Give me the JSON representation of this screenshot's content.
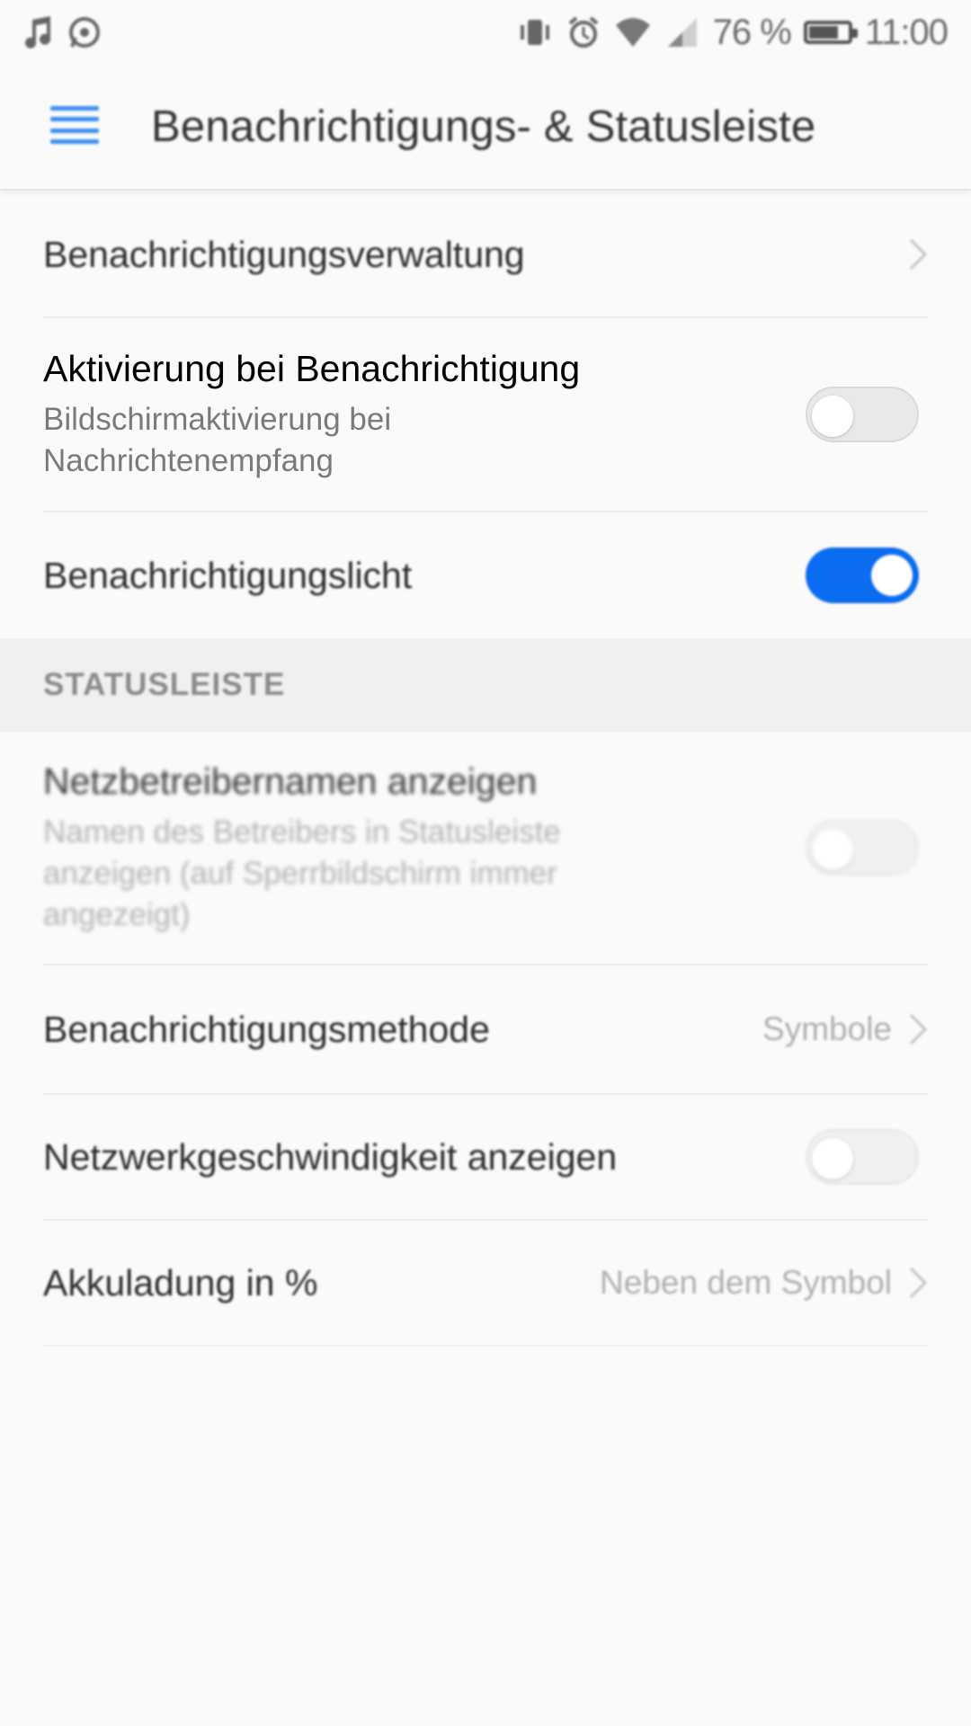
{
  "status_bar": {
    "left_icons": [
      "music-note-icon",
      "whatsapp-icon"
    ],
    "right_icons": [
      "vibrate-icon",
      "alarm-icon",
      "wifi-icon",
      "signal-icon"
    ],
    "battery_percent": "76 %",
    "time": "11:00"
  },
  "app_bar": {
    "menu_icon": "hamburger-menu-icon",
    "title": "Benachrichtigungs- & Statusleiste"
  },
  "colors": {
    "accent": "#0a6cf0",
    "menu_icon": "#3b8ff2"
  },
  "settings": {
    "notification_management": {
      "label": "Benachrichtigungsverwaltung"
    },
    "wake_on_notification": {
      "label": "Aktivierung bei Benachrichtigung",
      "sub_line1": "Bildschirmaktivierung bei",
      "sub_line2": "Nachrichtenempfang",
      "enabled": false
    },
    "notification_light": {
      "label": "Benachrichtigungslicht",
      "enabled": true
    }
  },
  "statusbar_section": {
    "header": "STATUSLEISTE",
    "carrier_name": {
      "label": "Netzbetreibernamen anzeigen",
      "sub_line1": "Namen des Betreibers in Statusleiste",
      "sub_line2": "anzeigen (auf Sperrbildschirm immer",
      "sub_line3": "angezeigt)",
      "enabled": false
    },
    "notification_method": {
      "label": "Benachrichtigungsmethode",
      "value": "Symbole"
    },
    "network_speed": {
      "label": "Netzwerkgeschwindigkeit anzeigen",
      "enabled": false
    },
    "battery_percent": {
      "label": "Akkuladung in %",
      "value": "Neben dem Symbol"
    }
  }
}
